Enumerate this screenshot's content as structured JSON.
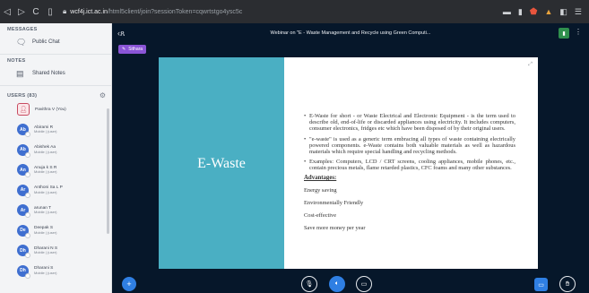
{
  "browser": {
    "url_host": "wcf4j.ict.ac.in",
    "url_path": "/html5client/join?sessionToken=cqwrtstgo4ysc5c"
  },
  "sidebar": {
    "messages_title": "MESSAGES",
    "public_chat": "Public Chat",
    "notes_title": "NOTES",
    "shared_notes": "Shared Notes",
    "users_title": "USERS (83)",
    "users": [
      {
        "initials": "",
        "name": "Pavithra V (You)",
        "role": "",
        "color": "#ffffff",
        "me": true
      },
      {
        "initials": "Ab",
        "name": "Abirami R",
        "role": "Mobile | (user)",
        "color": "#3f6fd0"
      },
      {
        "initials": "Ab",
        "name": "Abishek Aa",
        "role": "Mobile | (user)",
        "color": "#3f6fd0"
      },
      {
        "initials": "An",
        "name": "Anuja k S R",
        "role": "Mobile | (user)",
        "color": "#3f6fd0"
      },
      {
        "initials": "Ar",
        "name": "Anthoni Sa L P",
        "role": "Mobile | (user)",
        "color": "#3f6fd0"
      },
      {
        "initials": "Ar",
        "name": "arunan T",
        "role": "Mobile | (user)",
        "color": "#3f6fd0"
      },
      {
        "initials": "De",
        "name": "Deepak S",
        "role": "Mobile | (user)",
        "color": "#3f6fd0"
      },
      {
        "initials": "Dh",
        "name": "Dharani N S",
        "role": "Mobile | (user)",
        "color": "#3f6fd0"
      },
      {
        "initials": "Dh",
        "name": "Dharani S",
        "role": "Mobile | (user)",
        "color": "#3f6fd0"
      }
    ]
  },
  "main": {
    "title": "Webinar on \"E - Waste Management and Recycle using Green Computi...",
    "presenter": "Sithara"
  },
  "slide": {
    "title": "E-Waste",
    "bullets": [
      "E-Waste for short - or Waste Electrical and Electronic Equipment - is the term used to describe old, end-of-life or discarded appliances using electricity. It includes computers, consumer electronics, fridges etc which have been disposed of by their original users.",
      "\"e-waste\" is used as a generic term embracing all types of waste containing electrically powered components. e-Waste contains both valuable materials as well as hazardous materials which require special handling and recycling methods.",
      "Examples: Computers, LCD / CRT screens, cooling appliances, mobile phones, etc., contain precious metals, flame retarded plastics, CFC foams and many other substances."
    ],
    "advantages_heading": "Advantages:",
    "advantages": [
      "Energy saving",
      "Environmentally Friendly",
      "Cost-effective",
      "Save more money per year"
    ]
  },
  "colors": {
    "accent": "#2f7fe3",
    "slide_panel": "#4aafc3",
    "presenter_badge": "#8a55d6",
    "main_bg": "#06172a"
  }
}
